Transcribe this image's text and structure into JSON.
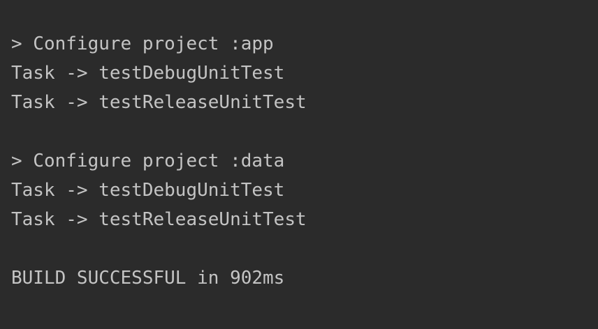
{
  "console": {
    "lines": [
      "> Configure project :app",
      "Task -> testDebugUnitTest",
      "Task -> testReleaseUnitTest",
      "",
      "> Configure project :data",
      "Task -> testDebugUnitTest",
      "Task -> testReleaseUnitTest",
      "",
      "BUILD SUCCESSFUL in 902ms"
    ]
  },
  "colors": {
    "background": "#2b2b2b",
    "text": "#c4c4c4"
  }
}
